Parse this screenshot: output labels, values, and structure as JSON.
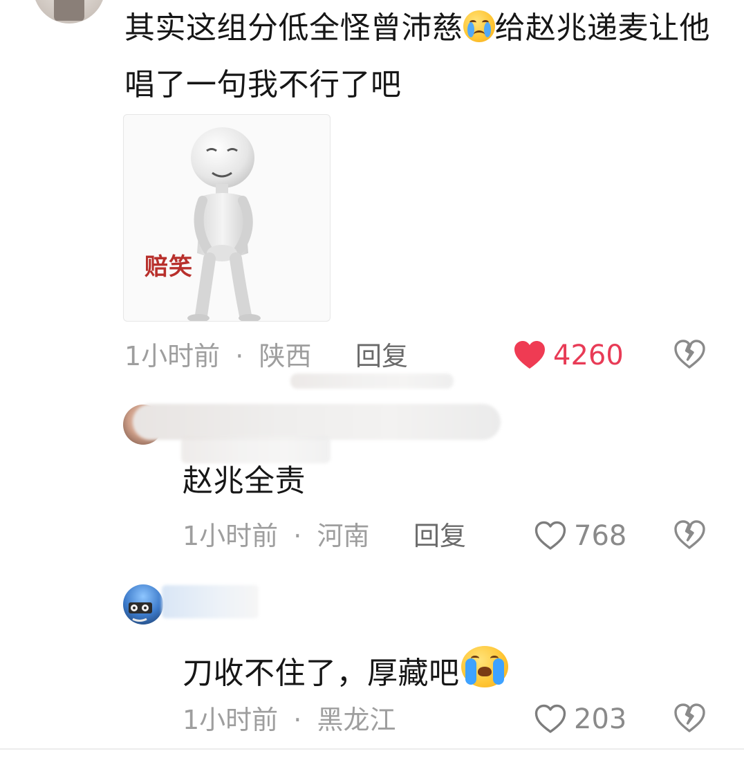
{
  "main_comment": {
    "text_part1": "其实这组分低全怪曾沛慈",
    "emoji_1": "crying-face-emoji",
    "text_part2": "给赵兆递麦让他唱了一句我不行了吧",
    "sticker_caption": "赔笑",
    "time": "1小时前",
    "location": "陕西",
    "reply_label": "回复",
    "like_count": "4260",
    "liked": true,
    "like_color": "#e83b56"
  },
  "replies": [
    {
      "text": "赵兆全责",
      "time": "1小时前",
      "location": "河南",
      "reply_label": "回复",
      "like_count": "768"
    },
    {
      "text": "刀收不住了，厚藏吧",
      "emoji": "loudly-crying-face-emoji",
      "time": "1小时前",
      "location": "黑龙江",
      "like_count": "203"
    }
  ],
  "separator": "·",
  "colors": {
    "meta_gray": "#9e9e9e",
    "text": "#161616",
    "like_red": "#e83b56"
  }
}
